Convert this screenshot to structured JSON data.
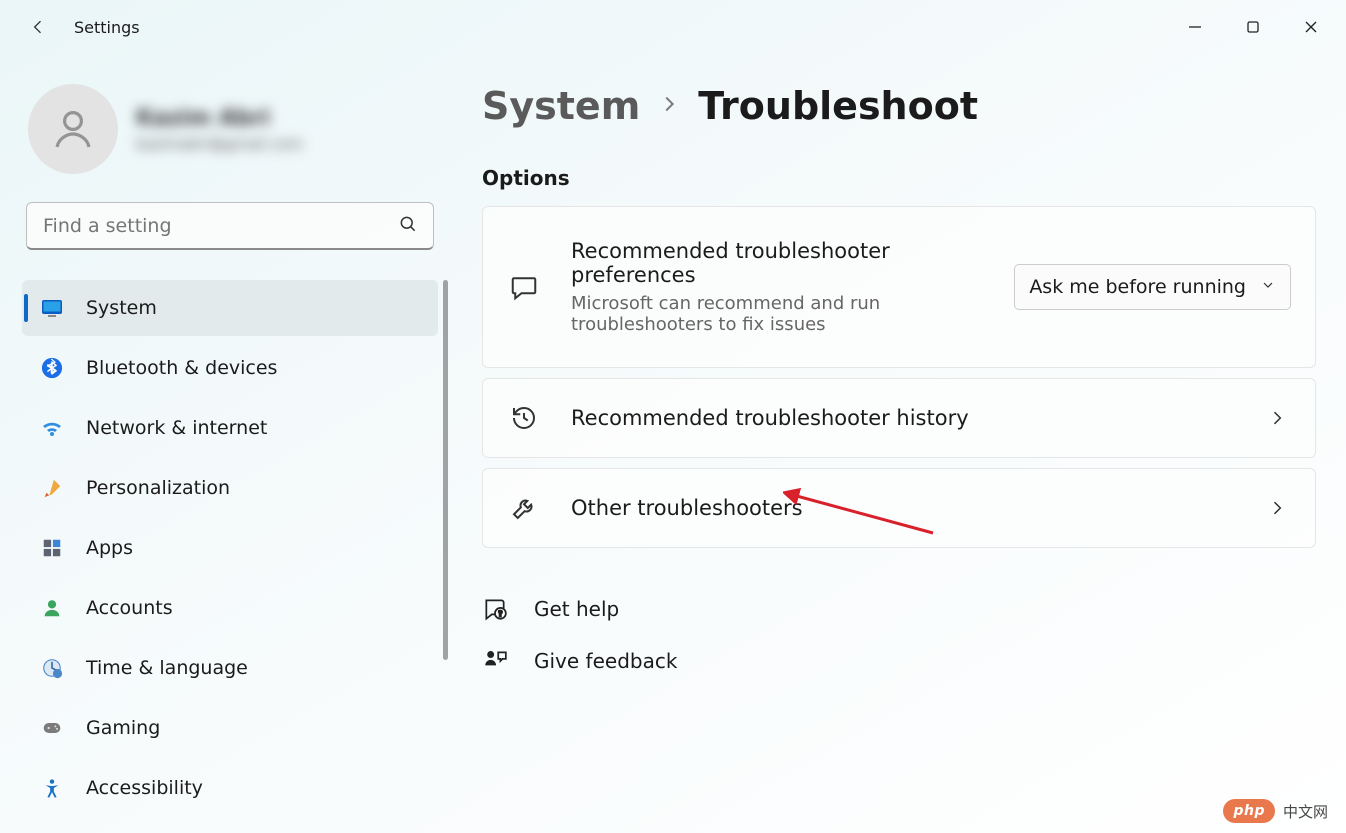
{
  "app": {
    "title": "Settings"
  },
  "user": {
    "name": "Kazim Abri",
    "email": "kazimabri@gmail.com"
  },
  "search": {
    "placeholder": "Find a setting"
  },
  "sidebar": {
    "items": [
      {
        "label": "System"
      },
      {
        "label": "Bluetooth & devices"
      },
      {
        "label": "Network & internet"
      },
      {
        "label": "Personalization"
      },
      {
        "label": "Apps"
      },
      {
        "label": "Accounts"
      },
      {
        "label": "Time & language"
      },
      {
        "label": "Gaming"
      },
      {
        "label": "Accessibility"
      }
    ]
  },
  "breadcrumb": {
    "parent": "System",
    "current": "Troubleshoot"
  },
  "content": {
    "section_title": "Options",
    "card_prefs": {
      "title": "Recommended troubleshooter preferences",
      "sub": "Microsoft can recommend and run troubleshooters to fix issues",
      "dropdown_label": "Ask me before running"
    },
    "card_history": {
      "title": "Recommended troubleshooter history"
    },
    "card_other": {
      "title": "Other troubleshooters"
    }
  },
  "footer": {
    "help": "Get help",
    "feedback": "Give feedback"
  },
  "watermark": {
    "pill": "php",
    "text": "中文网"
  }
}
